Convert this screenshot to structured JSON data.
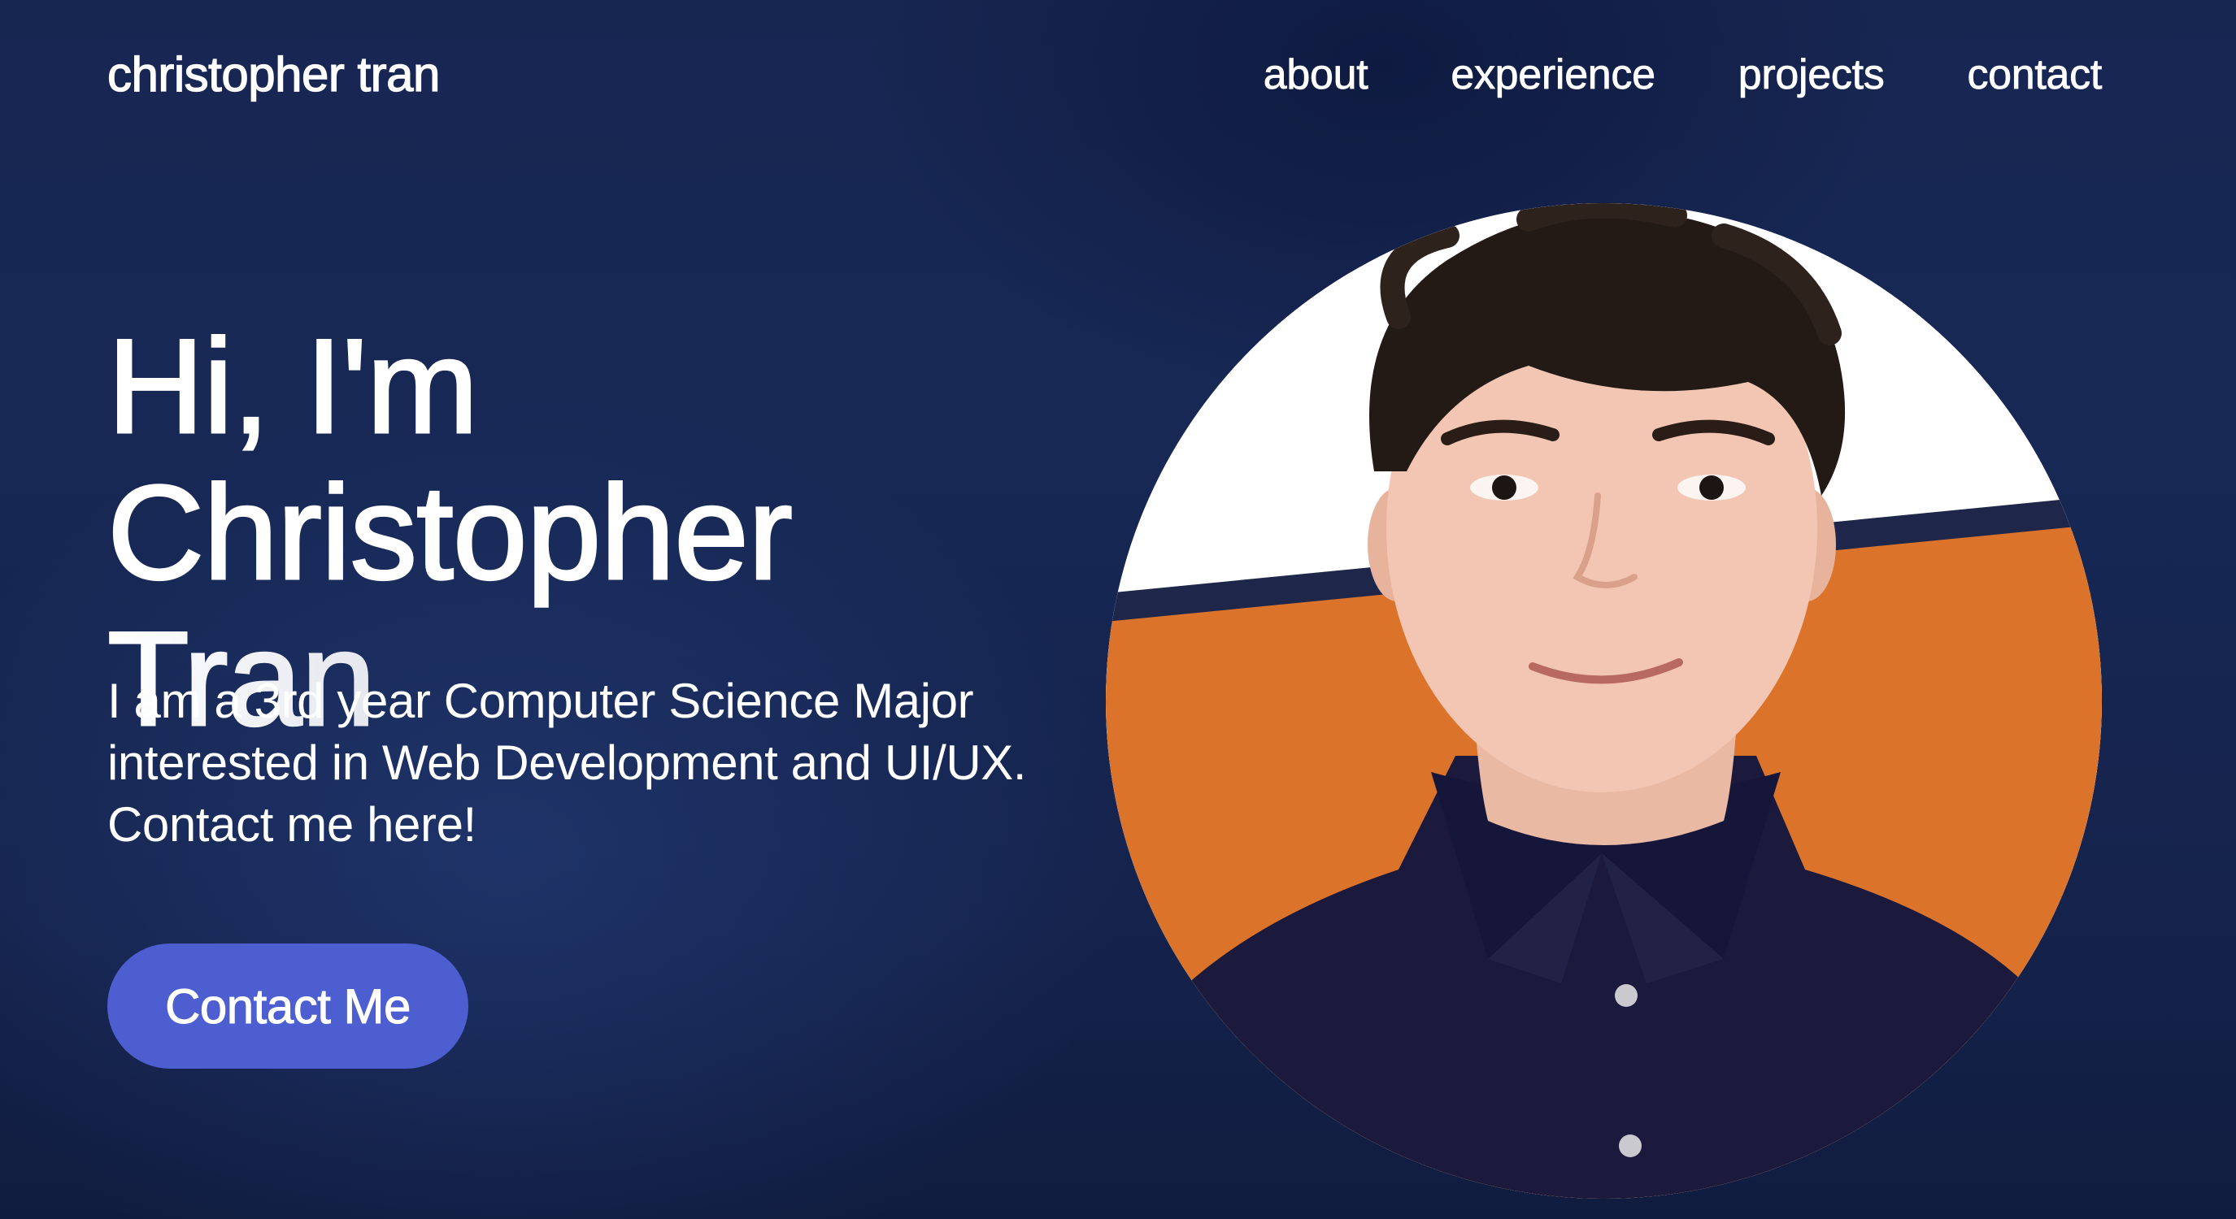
{
  "header": {
    "brand": "christopher tran",
    "nav": [
      {
        "label": "about"
      },
      {
        "label": "experience"
      },
      {
        "label": "projects"
      },
      {
        "label": "contact"
      }
    ]
  },
  "hero": {
    "greeting": "Hi, I'm",
    "name_first": "Christopher ",
    "name_last": "Tran",
    "description": "I am a 3rd year Computer Science Major interested in Web Development and UI/UX. Contact me here!",
    "cta_label": "Contact Me"
  },
  "colors": {
    "background": "#172651",
    "accent_button": "#4d5ed0",
    "portrait_orange": "#db732b",
    "portrait_stripe": "#1e2749",
    "shirt_navy": "#1b1a3d"
  }
}
